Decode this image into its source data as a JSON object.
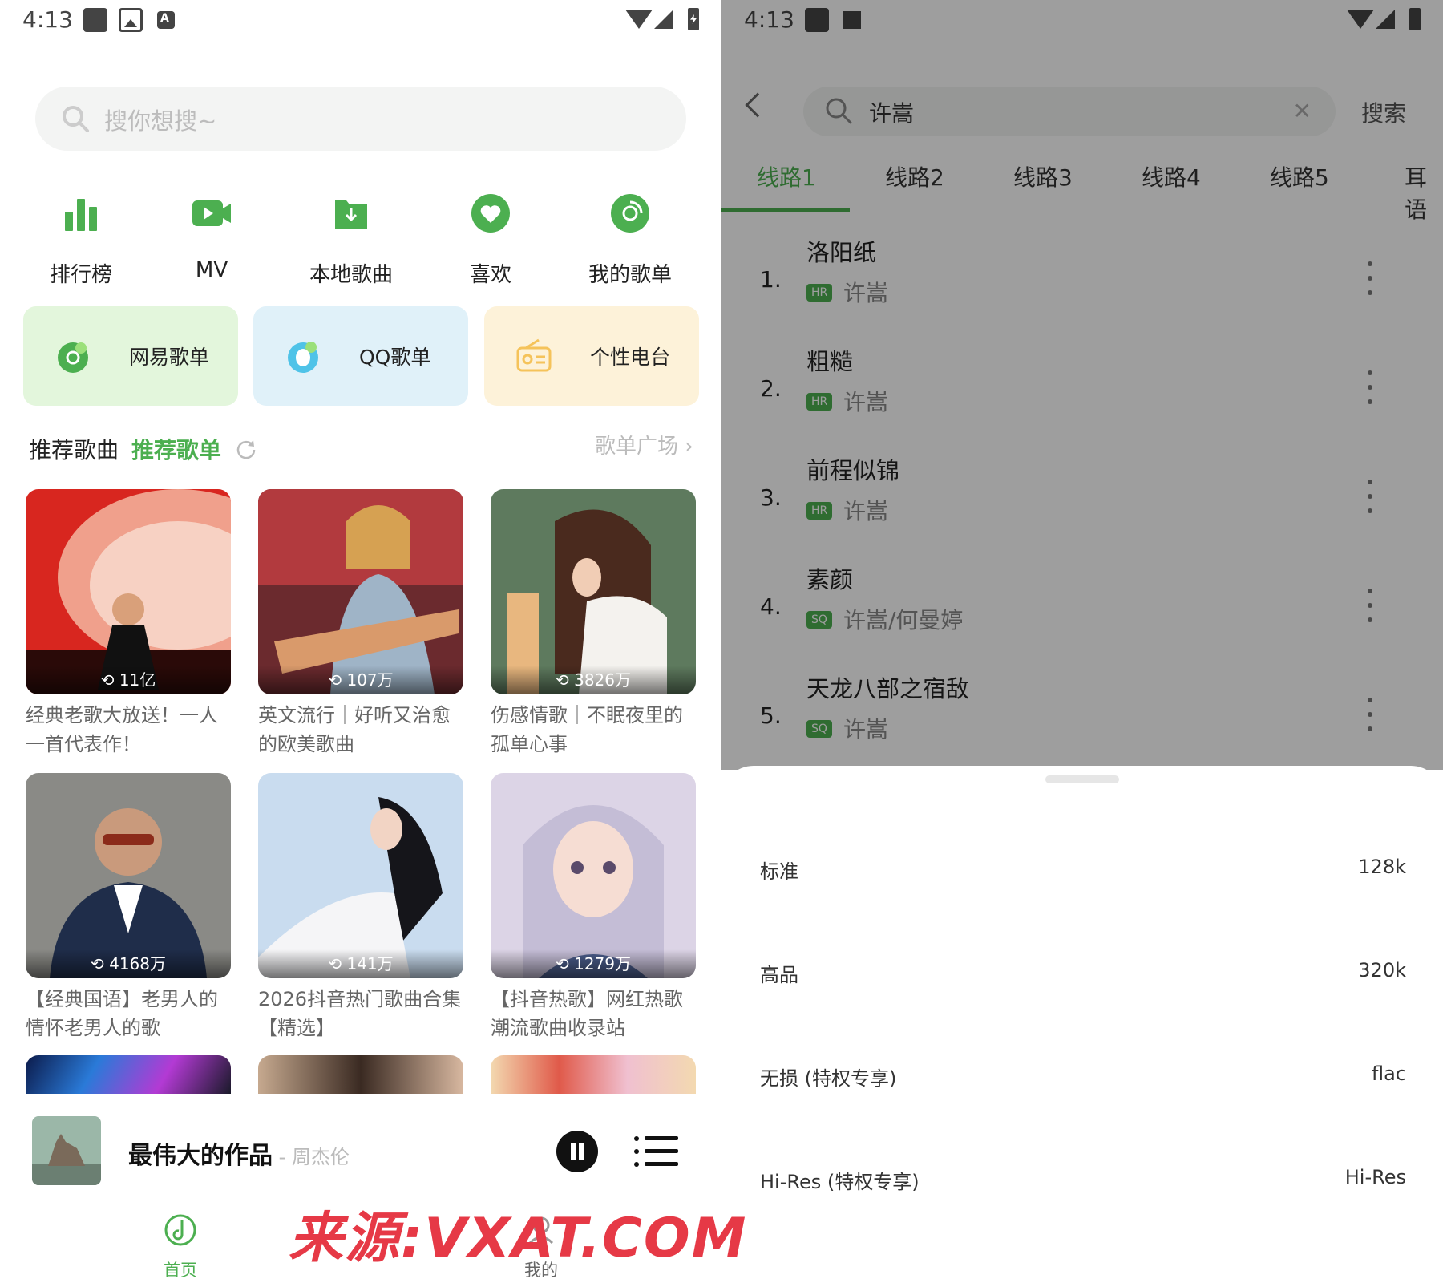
{
  "left": {
    "status": {
      "time": "4:13"
    },
    "search": {
      "placeholder": "搜你想搜~"
    },
    "quick": [
      {
        "label": "排行榜",
        "icon": "chart-bars-icon"
      },
      {
        "label": "MV",
        "icon": "video-camera-icon"
      },
      {
        "label": "本地歌曲",
        "icon": "download-folder-icon"
      },
      {
        "label": "喜欢",
        "icon": "heart-icon"
      },
      {
        "label": "我的歌单",
        "icon": "disc-icon"
      }
    ],
    "cards": [
      {
        "label": "网易歌单",
        "icon": "netease-icon",
        "bg": "#e3f6dc"
      },
      {
        "label": "QQ歌单",
        "icon": "qq-icon",
        "bg": "#e0f1f9"
      },
      {
        "label": "个性电台",
        "icon": "radio-icon",
        "bg": "#fdf2d9"
      }
    ],
    "section": {
      "tab1": "推荐歌曲",
      "tab2": "推荐歌单",
      "more": "歌单广场"
    },
    "playlists": [
      {
        "plays": "11亿",
        "caption": "经典老歌大放送！一人一首代表作！"
      },
      {
        "plays": "107万",
        "caption": "英文流行｜好听又治愈的欧美歌曲"
      },
      {
        "plays": "3826万",
        "caption": "伤感情歌｜不眠夜里的孤单心事"
      },
      {
        "plays": "4168万",
        "caption": "【经典国语】老男人的情怀老男人的歌"
      },
      {
        "plays": "141万",
        "caption": "2026抖音热门歌曲合集【精选】"
      },
      {
        "plays": "1279万",
        "caption": "【抖音热歌】网红热歌潮流歌曲收录站"
      }
    ],
    "player": {
      "song": "最伟大的作品",
      "artist": " - 周杰伦"
    },
    "nav": [
      {
        "label": "首页",
        "icon": "music-note-icon"
      },
      {
        "label": "我的",
        "icon": "user-icon"
      }
    ],
    "accent": "#4caf50"
  },
  "right": {
    "status": {
      "time": "4:13"
    },
    "search": {
      "value": "许嵩",
      "button": "搜索"
    },
    "routes": [
      "线路1",
      "线路2",
      "线路3",
      "线路4",
      "线路5",
      "耳语"
    ],
    "songs": [
      {
        "num": "1.",
        "title": "洛阳纸",
        "quality": "HR",
        "artist": "许嵩"
      },
      {
        "num": "2.",
        "title": "粗糙",
        "quality": "HR",
        "artist": "许嵩"
      },
      {
        "num": "3.",
        "title": "前程似锦",
        "quality": "HR",
        "artist": "许嵩"
      },
      {
        "num": "4.",
        "title": "素颜",
        "quality": "SQ",
        "artist": "许嵩/何曼婷"
      },
      {
        "num": "5.",
        "title": "天龙八部之宿敌",
        "quality": "SQ",
        "artist": "许嵩"
      }
    ],
    "qualities": [
      {
        "name": "标准",
        "value": "128k"
      },
      {
        "name": "高品",
        "value": "320k"
      },
      {
        "name": "无损 (特权专享)",
        "value": "flac"
      },
      {
        "name": "Hi-Res (特权专享)",
        "value": "Hi-Res"
      }
    ],
    "watermark": "来源:VXAT.COM"
  }
}
